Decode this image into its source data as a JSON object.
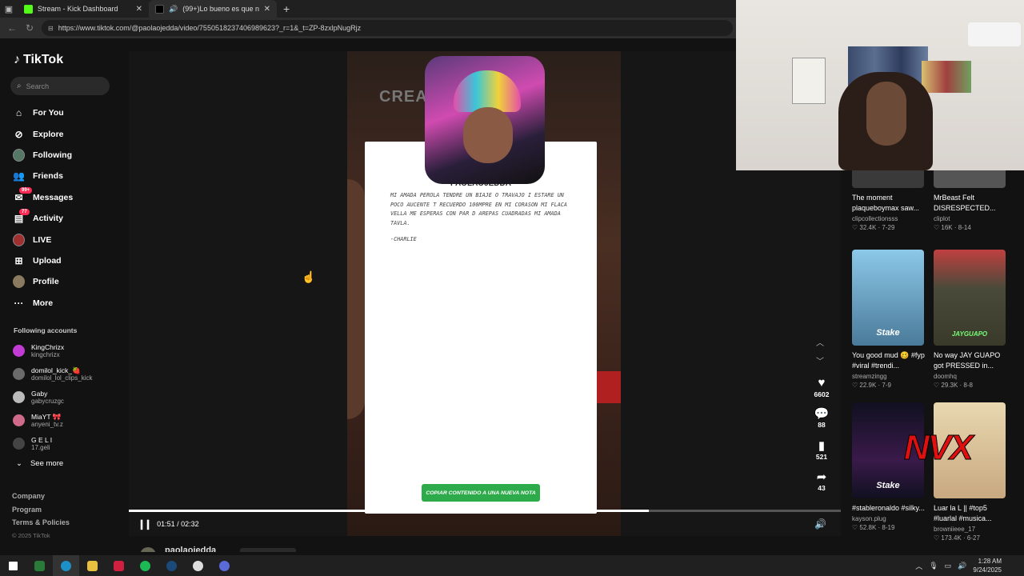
{
  "browser": {
    "tabs": [
      {
        "title": "Stream - Kick Dashboard",
        "favicon_color": "#53fc18"
      },
      {
        "title": "(99+)Lo bueno es que no ter",
        "favicon_color": "#000000"
      }
    ],
    "url": "https://www.tiktok.com/@paolaojedda/video/7550518237406989623?_r=1&_t=ZP-8zxlpNugRjz"
  },
  "sidebar": {
    "logo": "TikTok",
    "search_placeholder": "Search",
    "nav": [
      {
        "label": "For You",
        "icon": "home-icon"
      },
      {
        "label": "Explore",
        "icon": "compass-icon"
      },
      {
        "label": "Following",
        "icon": "avatar-icon"
      },
      {
        "label": "Friends",
        "icon": "friends-icon"
      },
      {
        "label": "Messages",
        "icon": "messages-icon",
        "badge": "99+"
      },
      {
        "label": "Activity",
        "icon": "activity-icon",
        "badge": "77"
      },
      {
        "label": "LIVE",
        "icon": "live-icon"
      },
      {
        "label": "Upload",
        "icon": "upload-icon"
      },
      {
        "label": "Profile",
        "icon": "profile-icon"
      },
      {
        "label": "More",
        "icon": "more-icon"
      }
    ],
    "following_title": "Following accounts",
    "accounts": [
      {
        "name": "KingChrizx",
        "handle": "kingchrizx",
        "color": "#c23bd4"
      },
      {
        "name": "domilol_kick_🍓",
        "handle": "domilol_lol_clips_kick",
        "color": "#6a6a6a"
      },
      {
        "name": "Gaby",
        "handle": "gabycruzgc",
        "color": "#bbbbbb"
      },
      {
        "name": "MiaYT 🎀",
        "handle": "anyeni_tv.z",
        "color": "#d06a8a"
      },
      {
        "name": "G E L I",
        "handle": "17.geli",
        "color": "#444444"
      }
    ],
    "see_more": "See more",
    "footer": [
      "Company",
      "Program",
      "Terms & Policies"
    ],
    "copyright": "© 2025 TikTok"
  },
  "video": {
    "sign_text": "CREA",
    "note_handle": "PAOLAOJEDDA",
    "note_body": "MI AMADA PEROLA TENDRE UN BIAJE O TRAVAJO I ESTARE UN POCO AUCENTE T RECUERDO 100MPRE EN MI CORASON MI FLACA VELLA ME ESPERAS CON PAR D AREPAS CUADRADAS MI AMADA TAVLA.",
    "note_signature": "-CHARLIE",
    "copy_button": "COPIAR CONTENIDO A UNA NUEVA NOTA",
    "time": "01:51 / 02:32",
    "progress": 0.73,
    "author": "paolaojedda"
  },
  "actions": [
    {
      "icon": "heart-icon",
      "count": "6602"
    },
    {
      "icon": "comment-icon",
      "count": "88"
    },
    {
      "icon": "bookmark-icon",
      "count": "521"
    },
    {
      "icon": "share-icon",
      "count": "43"
    }
  ],
  "related": [
    {
      "title": "The moment plaqueboymax saw...",
      "user": "clipcollectionsss",
      "likes": "32.4K",
      "date": "7-29",
      "thumb": "#3a3a3a"
    },
    {
      "title": "MrBeast Felt DISRESPECTED...",
      "user": "cliplot",
      "likes": "16K",
      "date": "8-14",
      "thumb": "#555555"
    },
    {
      "title": "You good mud 🥴 #fyp #viral #trendi...",
      "user": "streamzingg",
      "likes": "22.9K",
      "date": "7-9",
      "thumb": "#6aa8c8",
      "overlay": "Stake"
    },
    {
      "title": "No way JAY GUAPO got PRESSED in...",
      "user": "doomhq",
      "likes": "29.3K",
      "date": "8-8",
      "thumb": "#5a5a4a",
      "overlay": "JAYGUAPO"
    },
    {
      "title": "#stableronaldo #silky...",
      "user": "kayson.plug",
      "likes": "52.8K",
      "date": "8-19",
      "thumb": "#1a1a2a",
      "overlay": "Stake"
    },
    {
      "title": "Luar la L || #top5 #luarlal #musica...",
      "user": "browniieee_17",
      "likes": "173.4K",
      "date": "6-27",
      "thumb": "#d8c8a0"
    }
  ],
  "nvx_logo": "NVX",
  "taskbar": {
    "time": "1:28 AM",
    "date": "9/24/2025"
  }
}
